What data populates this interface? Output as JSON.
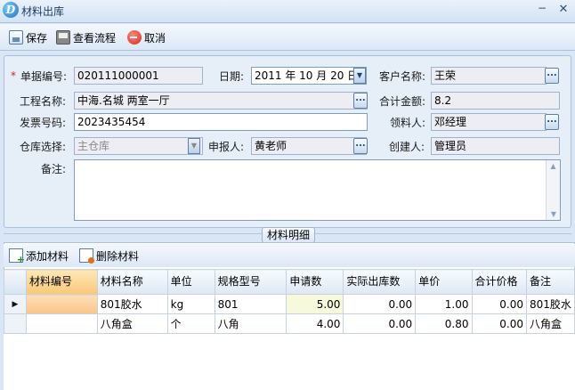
{
  "window": {
    "title": "材料出库",
    "logo_letter": "D",
    "minimize": "−",
    "close": "✕"
  },
  "toolbar": {
    "save": "保存",
    "view_flow": "查看流程",
    "cancel": "取消"
  },
  "form": {
    "doc_no_label": "单据编号:",
    "doc_no": "020111000001",
    "date_label": "日期:",
    "date": "2011 年 10 月 20 日",
    "customer_label": "客户名称:",
    "customer": "王荣",
    "project_label": "工程名称:",
    "project": "中海.名城 两室一厅",
    "total_label": "合计金额:",
    "total": "8.2",
    "invoice_label": "发票号码:",
    "invoice": "2023435454",
    "receiver_label": "领料人:",
    "receiver": "邓经理",
    "warehouse_label": "仓库选择:",
    "warehouse": "主仓库",
    "applicant_label": "申报人:",
    "applicant": "黄老师",
    "creator_label": "创建人:",
    "creator": "管理员",
    "remark_label": "备注:",
    "remark": "",
    "required_mark": "*",
    "ellipsis": "..."
  },
  "detail_tab": "材料明细",
  "grid_toolbar": {
    "add": "添加材料",
    "delete": "删除材料"
  },
  "grid": {
    "columns": [
      "材料编号",
      "材料名称",
      "单位",
      "规格型号",
      "申请数",
      "实际出库数",
      "单价",
      "合计价格",
      "备注"
    ],
    "rows": [
      {
        "indicator": "▶",
        "code": "",
        "name": "801胶水",
        "unit": "kg",
        "spec": "801",
        "apply": "5.00",
        "actual": "0.00",
        "price": "1.00",
        "subtotal": "0.00",
        "remark": "801胶水"
      },
      {
        "indicator": "",
        "code": "",
        "name": "八角盒",
        "unit": "个",
        "spec": "八角",
        "apply": "4.00",
        "actual": "0.00",
        "price": "0.80",
        "subtotal": "0.00",
        "remark": "八角盒"
      }
    ]
  }
}
